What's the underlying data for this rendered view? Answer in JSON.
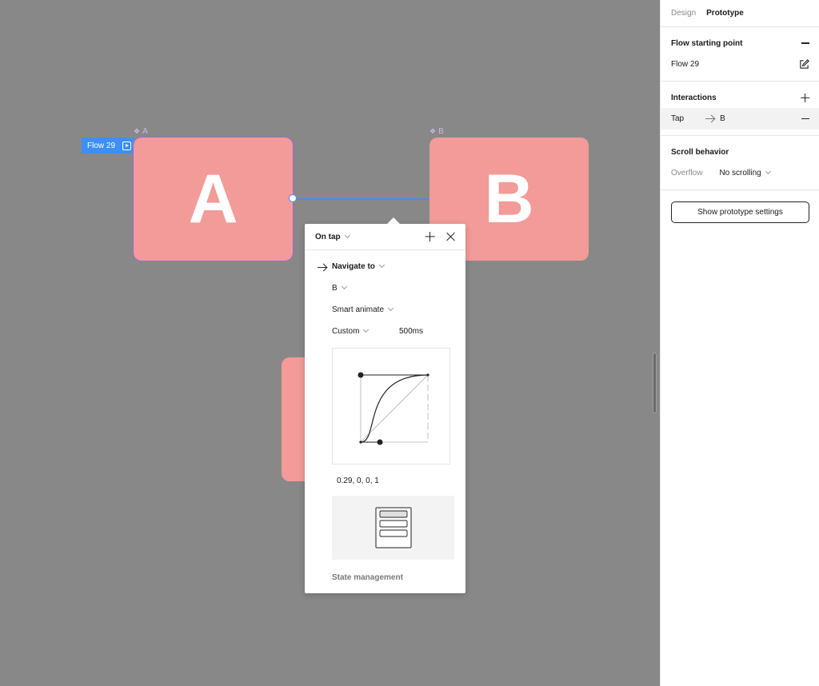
{
  "canvas": {
    "frame_a": {
      "label": "A",
      "letter": "A"
    },
    "frame_b": {
      "label": "B",
      "letter": "B"
    },
    "flow_badge": "Flow 29"
  },
  "popover": {
    "trigger": "On tap",
    "action": "Navigate to",
    "destination": "B",
    "animation": "Smart animate",
    "easing": "Custom",
    "duration": "500ms",
    "curve_values": "0.29, 0, 0, 1",
    "state_label": "State management"
  },
  "panel": {
    "tabs": [
      {
        "label": "Design",
        "active": false
      },
      {
        "label": "Prototype",
        "active": true
      }
    ],
    "flow_section": {
      "title": "Flow starting point",
      "flow_name": "Flow 29"
    },
    "interactions_section": {
      "title": "Interactions",
      "trigger": "Tap",
      "target": "B"
    },
    "scroll_section": {
      "title": "Scroll behavior",
      "overflow_label": "Overflow",
      "overflow_value": "No scrolling"
    },
    "settings_button": "Show prototype settings"
  },
  "colors": {
    "frame_fill": "#f29b98",
    "accent_blue": "#3d8ff5",
    "component_purple": "#9b6bd6",
    "canvas_bg": "#888888"
  },
  "icons": [
    "component-diamond-icon",
    "play-frame-icon",
    "plus-icon",
    "close-icon",
    "arrow-right-icon",
    "chevron-down-icon",
    "edit-icon",
    "minus-icon",
    "state-preview-icon"
  ]
}
